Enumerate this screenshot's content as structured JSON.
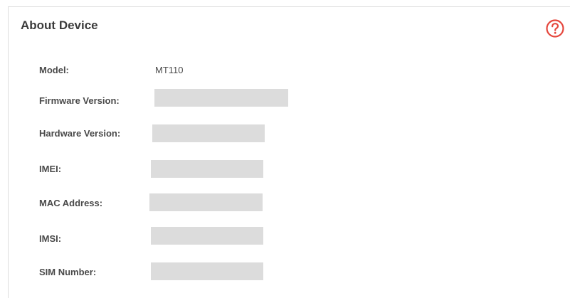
{
  "panel": {
    "title": "About Device",
    "help_icon": "help-circle-icon",
    "accent_color": "#e5463c"
  },
  "fields": {
    "model": {
      "label": "Model:",
      "value": "MT110"
    },
    "firmware": {
      "label": "Firmware Version:"
    },
    "hardware": {
      "label": "Hardware Version:"
    },
    "imei": {
      "label": "IMEI:"
    },
    "mac": {
      "label": "MAC Address:"
    },
    "imsi": {
      "label": "IMSI:"
    },
    "sim": {
      "label": "SIM Number:"
    }
  }
}
